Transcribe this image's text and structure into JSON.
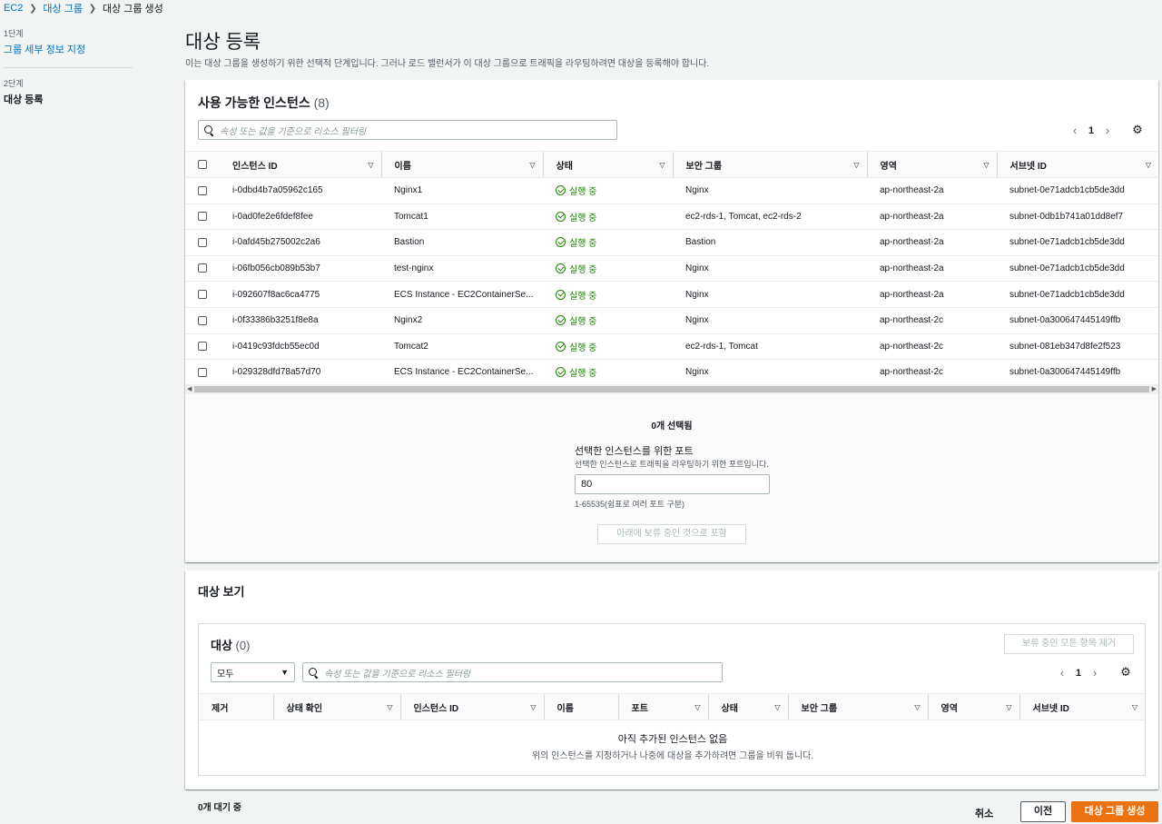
{
  "breadcrumb": {
    "items": [
      "EC2",
      "대상 그룹"
    ],
    "current": "대상 그룹 생성"
  },
  "steps": [
    {
      "num": "1단계",
      "label": "그룹 세부 정보 지정"
    },
    {
      "num": "2단계",
      "label": "대상 등록"
    }
  ],
  "page": {
    "title": "대상 등록",
    "description": "이는 대상 그룹을 생성하기 위한 선택적 단계입니다. 그러나 로드 밸런서가 이 대상 그룹으로 트래픽을 라우팅하려면 대상을 등록해야 합니다."
  },
  "available": {
    "title": "사용 가능한 인스턴스",
    "count": "(8)",
    "filter_placeholder": "속성 또는 값을 기준으로 리소스 필터링",
    "page": "1",
    "columns": [
      "인스턴스 ID",
      "이름",
      "상태",
      "보안 그룹",
      "영역",
      "서브넷 ID"
    ],
    "rows": [
      {
        "id": "i-0dbd4b7a05962c165",
        "name": "Nginx1",
        "state": "실행 중",
        "sg": "Nginx",
        "zone": "ap-northeast-2a",
        "subnet": "subnet-0e71adcb1cb5de3dd"
      },
      {
        "id": "i-0ad0fe2e6fdef8fee",
        "name": "Tomcat1",
        "state": "실행 중",
        "sg": "ec2-rds-1, Tomcat, ec2-rds-2",
        "zone": "ap-northeast-2a",
        "subnet": "subnet-0db1b741a01dd8ef7"
      },
      {
        "id": "i-0afd45b275002c2a6",
        "name": "Bastion",
        "state": "실행 중",
        "sg": "Bastion",
        "zone": "ap-northeast-2a",
        "subnet": "subnet-0e71adcb1cb5de3dd"
      },
      {
        "id": "i-06fb056cb089b53b7",
        "name": "test-nginx",
        "state": "실행 중",
        "sg": "Nginx",
        "zone": "ap-northeast-2a",
        "subnet": "subnet-0e71adcb1cb5de3dd"
      },
      {
        "id": "i-092607f8ac6ca4775",
        "name": "ECS Instance - EC2ContainerSe...",
        "state": "실행 중",
        "sg": "Nginx",
        "zone": "ap-northeast-2a",
        "subnet": "subnet-0e71adcb1cb5de3dd"
      },
      {
        "id": "i-0f33386b3251f8e8a",
        "name": "Nginx2",
        "state": "실행 중",
        "sg": "Nginx",
        "zone": "ap-northeast-2c",
        "subnet": "subnet-0a300647445149ffb"
      },
      {
        "id": "i-0419c93fdcb55ec0d",
        "name": "Tomcat2",
        "state": "실행 중",
        "sg": "ec2-rds-1, Tomcat",
        "zone": "ap-northeast-2c",
        "subnet": "subnet-081eb347d8fe2f523"
      },
      {
        "id": "i-029328dfd78a57d70",
        "name": "ECS Instance - EC2ContainerSe...",
        "state": "실행 중",
        "sg": "Nginx",
        "zone": "ap-northeast-2c",
        "subnet": "subnet-0a300647445149ffb"
      }
    ],
    "selected_count": "0개 선택됨",
    "port_label": "선택한 인스턴스를 위한 포트",
    "port_desc": "선택한 인스턴스로 트래픽을 라우팅하기 위한 포트입니다.",
    "port_value": "80",
    "port_hint": "1-65535(쉼표로 여러 포트 구분)",
    "include_button": "아래에 보류 중인 것으로 포함"
  },
  "review": {
    "title": "대상 보기",
    "targets_title": "대상",
    "targets_count": "(0)",
    "remove_all_button": "보류 중인 모든 항목 제거",
    "select_value": "모두",
    "filter_placeholder": "속성 또는 값을 기준으로 리소스 필터링",
    "page": "1",
    "columns": [
      "제거",
      "상태 확인",
      "인스턴스 ID",
      "이름",
      "포트",
      "상태",
      "보안 그룹",
      "영역",
      "서브넷 ID"
    ],
    "empty_title": "아직 추가된 인스턴스 없음",
    "empty_desc": "위의 인스턴스를 지정하거나 나중에 대상을 추가하려면 그룹을 비워 둡니다."
  },
  "footer": {
    "pending": "0개 대기 중",
    "cancel": "취소",
    "previous": "이전",
    "create": "대상 그룹 생성"
  },
  "colors": {
    "link": "#0073bb",
    "success": "#1d8102",
    "primary": "#ec7211"
  }
}
